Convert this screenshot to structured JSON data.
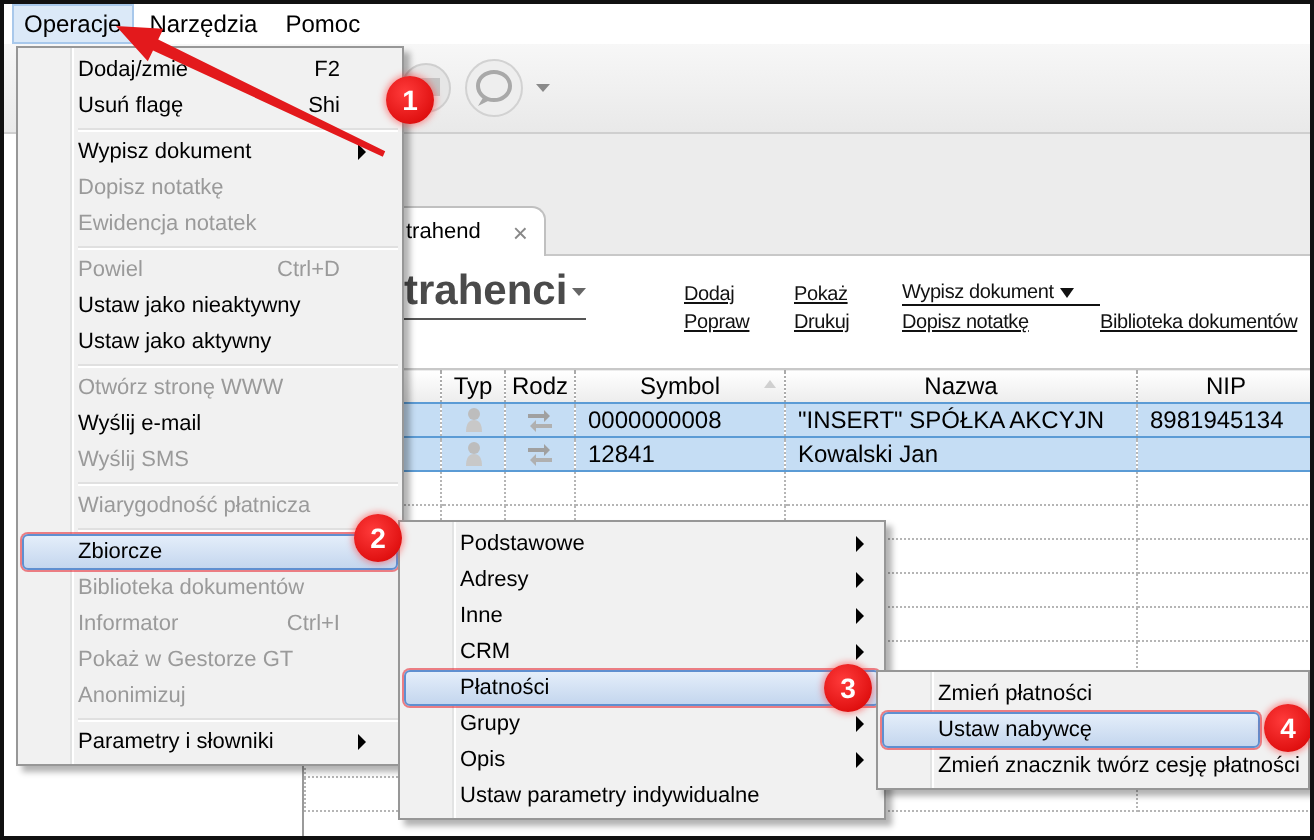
{
  "menu_bar": [
    {
      "label": "Operacje",
      "selected": true
    },
    {
      "label": "Narzędzia",
      "selected": false
    },
    {
      "label": "Pomoc",
      "selected": false
    }
  ],
  "tab": {
    "label": "trahend",
    "close": "×"
  },
  "heading": "trahenci",
  "action_columns": [
    [
      {
        "label": "Dodaj",
        "menu": false
      },
      {
        "label": "Popraw",
        "menu": false
      }
    ],
    [
      {
        "label": "Pokaż",
        "menu": false
      },
      {
        "label": "Drukuj",
        "menu": false
      }
    ],
    [
      {
        "label": "Wypisz dokument",
        "menu": true
      },
      {
        "label": "Dopisz notatkę",
        "menu": false
      }
    ],
    [
      {
        "label": "Biblioteka dokumentów",
        "menu": false
      }
    ]
  ],
  "table": {
    "columns": [
      "Typ",
      "Rodz",
      "Symbol",
      "Nazwa",
      "NIP"
    ],
    "rows": [
      {
        "selected": true,
        "symbol": "0000000008",
        "name": "\"INSERT\" SPÓŁKA AKCYJN",
        "nip": "8981945134"
      },
      {
        "selected": true,
        "symbol": "12841",
        "name": "Kowalski Jan"
      }
    ]
  },
  "menus": [
    {
      "items": [
        {
          "kind": "item",
          "label": "Dodaj/zmie",
          "shortcut": "F2",
          "disabled": false,
          "submenu": false,
          "selected": false
        },
        {
          "kind": "item",
          "label": "Usuń flagę",
          "shortcut": "Shi",
          "disabled": false,
          "submenu": false,
          "selected": false
        },
        {
          "kind": "separator"
        },
        {
          "kind": "item",
          "label": "Wypisz dokument",
          "disabled": false,
          "submenu": true,
          "selected": false
        },
        {
          "kind": "item",
          "label": "Dopisz notatkę",
          "disabled": true,
          "submenu": false,
          "selected": false
        },
        {
          "kind": "item",
          "label": "Ewidencja notatek",
          "disabled": true,
          "submenu": false,
          "selected": false
        },
        {
          "kind": "separator"
        },
        {
          "kind": "item",
          "label": "Powiel",
          "shortcut": "Ctrl+D",
          "disabled": true,
          "submenu": false,
          "selected": false
        },
        {
          "kind": "item",
          "label": "Ustaw jako nieaktywny",
          "disabled": false,
          "submenu": false,
          "selected": false
        },
        {
          "kind": "item",
          "label": "Ustaw jako aktywny",
          "disabled": false,
          "submenu": false,
          "selected": false
        },
        {
          "kind": "separator"
        },
        {
          "kind": "item",
          "label": "Otwórz stronę WWW",
          "disabled": true,
          "submenu": false,
          "selected": false
        },
        {
          "kind": "item",
          "label": "Wyślij e-mail",
          "disabled": false,
          "submenu": false,
          "selected": false
        },
        {
          "kind": "item",
          "label": "Wyślij SMS",
          "disabled": true,
          "submenu": false,
          "selected": false
        },
        {
          "kind": "separator"
        },
        {
          "kind": "item",
          "label": "Wiarygodność płatnicza",
          "disabled": true,
          "submenu": false,
          "selected": false
        },
        {
          "kind": "separator"
        },
        {
          "kind": "item",
          "label": "Zbiorcze",
          "disabled": false,
          "submenu": false,
          "selected": true
        },
        {
          "kind": "item",
          "label": "Biblioteka dokumentów",
          "disabled": true,
          "submenu": false,
          "selected": false
        },
        {
          "kind": "item",
          "label": "Informator",
          "shortcut": "Ctrl+I",
          "disabled": true,
          "submenu": false,
          "selected": false
        },
        {
          "kind": "item",
          "label": "Pokaż w Gestorze GT",
          "disabled": true,
          "submenu": false,
          "selected": false
        },
        {
          "kind": "item",
          "label": "Anonimizuj",
          "disabled": true,
          "submenu": false,
          "selected": false
        },
        {
          "kind": "separator"
        },
        {
          "kind": "item",
          "label": "Parametry i słowniki",
          "disabled": false,
          "submenu": true,
          "selected": false
        }
      ]
    },
    {
      "items": [
        {
          "kind": "item",
          "label": "Podstawowe",
          "disabled": false,
          "submenu": true,
          "selected": false
        },
        {
          "kind": "item",
          "label": "Adresy",
          "disabled": false,
          "submenu": true,
          "selected": false
        },
        {
          "kind": "item",
          "label": "Inne",
          "disabled": false,
          "submenu": true,
          "selected": false
        },
        {
          "kind": "item",
          "label": "CRM",
          "disabled": false,
          "submenu": true,
          "selected": false
        },
        {
          "kind": "item",
          "label": "Płatności",
          "disabled": false,
          "submenu": false,
          "selected": true
        },
        {
          "kind": "item",
          "label": "Grupy",
          "disabled": false,
          "submenu": true,
          "selected": false
        },
        {
          "kind": "item",
          "label": "Opis",
          "disabled": false,
          "submenu": true,
          "selected": false
        },
        {
          "kind": "item",
          "label": "Ustaw parametry indywidualne",
          "disabled": false,
          "submenu": false,
          "selected": false
        }
      ]
    },
    {
      "items": [
        {
          "kind": "item",
          "label": "Zmień płatności",
          "disabled": false,
          "submenu": false,
          "selected": false
        },
        {
          "kind": "item",
          "label": "Ustaw nabywcę",
          "disabled": false,
          "submenu": false,
          "selected": true
        },
        {
          "kind": "item",
          "label": "Zmień znacznik twórz cesję płatności",
          "disabled": false,
          "submenu": false,
          "selected": false
        }
      ]
    }
  ],
  "annotations": [
    {
      "number": "1"
    },
    {
      "number": "2"
    },
    {
      "number": "3"
    },
    {
      "number": "4"
    }
  ]
}
